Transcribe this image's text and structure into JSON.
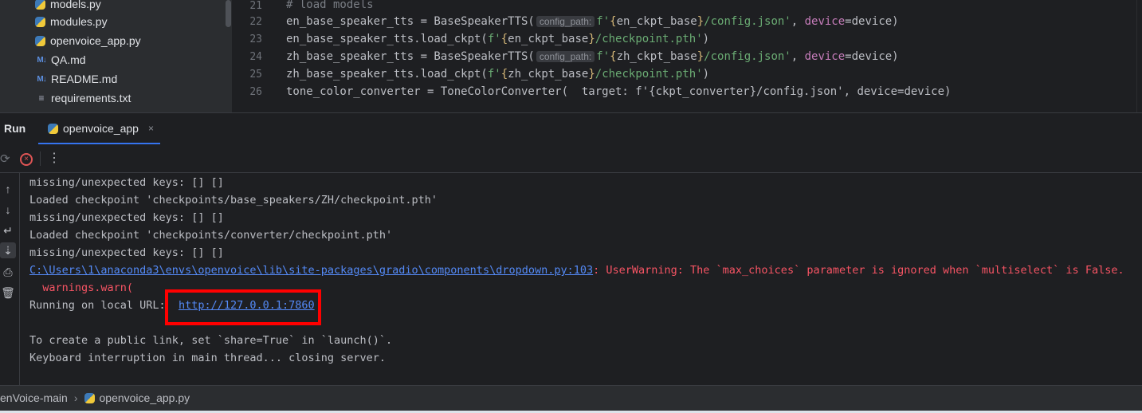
{
  "project_tree": {
    "items": [
      {
        "name": "models.py",
        "type": "py"
      },
      {
        "name": "modules.py",
        "type": "py"
      },
      {
        "name": "openvoice_app.py",
        "type": "py"
      },
      {
        "name": "QA.md",
        "type": "md"
      },
      {
        "name": "README.md",
        "type": "md"
      },
      {
        "name": "requirements.txt",
        "type": "txt"
      }
    ]
  },
  "editor": {
    "lines": [
      {
        "num": "21",
        "text": "# load models"
      },
      {
        "num": "22",
        "pre": "en_base_speaker_tts = BaseSpeakerTTS(",
        "hint": "config_path:",
        "str_a": "f'",
        "brace_a": "{",
        "var": "en_ckpt_base",
        "brace_b": "}",
        "str_b": "/config.json'",
        "sep": ", ",
        "param": "device",
        "post": "=device)"
      },
      {
        "num": "23",
        "pre": "en_base_speaker_tts.load_ckpt(",
        "str_a": "f'",
        "brace_a": "{",
        "var": "en_ckpt_base",
        "brace_b": "}",
        "str_b": "/checkpoint.pth'",
        "post": ")"
      },
      {
        "num": "24",
        "pre": "zh_base_speaker_tts = BaseSpeakerTTS(",
        "hint": "config_path:",
        "str_a": "f'",
        "brace_a": "{",
        "var": "zh_ckpt_base",
        "brace_b": "}",
        "str_b": "/config.json'",
        "sep": ", ",
        "param": "device",
        "post": "=device)"
      },
      {
        "num": "25",
        "pre": "zh_base_speaker_tts.load_ckpt(",
        "str_a": "f'",
        "brace_a": "{",
        "var": "zh_ckpt_base",
        "brace_b": "}",
        "str_b": "/checkpoint.pth'",
        "post": ")"
      },
      {
        "num": "26",
        "text": "tone_color_converter = ToneColorConverter(  target: f'{ckpt_converter}/config.json', device=device)"
      }
    ]
  },
  "run_panel": {
    "label": "Run",
    "tab_label": "openvoice_app",
    "tab_close": "×",
    "more": "⋮"
  },
  "console": {
    "lines": [
      "missing/unexpected keys: [] []",
      "Loaded checkpoint 'checkpoints/base_speakers/ZH/checkpoint.pth'",
      "missing/unexpected keys: [] []",
      "Loaded checkpoint 'checkpoints/converter/checkpoint.pth'",
      "missing/unexpected keys: [] []"
    ],
    "warning_path": "C:\\Users\\1\\anaconda3\\envs\\openvoice\\lib\\site-packages\\gradio\\components\\dropdown.py:103",
    "warning_msg": ": UserWarning: The `max_choices` parameter is ignored when `multiselect` is False.",
    "warning_call": "  warnings.warn(",
    "running_prefix": "Running on local URL:  ",
    "running_url": "http://127.0.0.1:7860",
    "public_link": "To create a public link, set `share=True` in `launch()`.",
    "interrupt": "Keyboard interruption in main thread... closing server."
  },
  "status_bar": {
    "project": "enVoice-main",
    "separator": "›",
    "file": "openvoice_app.py"
  },
  "colors": {
    "highlight_box": "#ff0000",
    "link": "#548af7",
    "error": "#f75464"
  }
}
